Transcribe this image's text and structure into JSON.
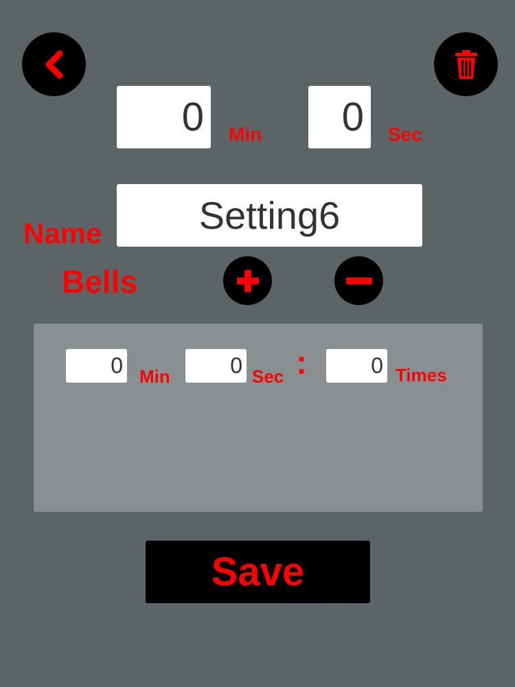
{
  "colors": {
    "background": "#5d6466",
    "accent": "#ff0000",
    "button_bg": "#000000",
    "field_bg": "#ffffff",
    "panel_bg": "#8a8f91"
  },
  "header": {
    "back_icon": "chevron-left-icon",
    "delete_icon": "trash-icon"
  },
  "timer": {
    "min_value": "0",
    "min_label": "Min",
    "sec_value": "0",
    "sec_label": "Sec"
  },
  "name": {
    "label": "Name",
    "value": "Setting6"
  },
  "bells": {
    "label": "Bells",
    "add_icon": "plus-icon",
    "remove_icon": "minus-icon",
    "items": [
      {
        "min_value": "0",
        "min_label": "Min",
        "sec_value": "0",
        "sec_label": "Sec",
        "separator": ":",
        "times_value": "0",
        "times_label": "Times"
      }
    ]
  },
  "footer": {
    "save_label": "Save"
  }
}
